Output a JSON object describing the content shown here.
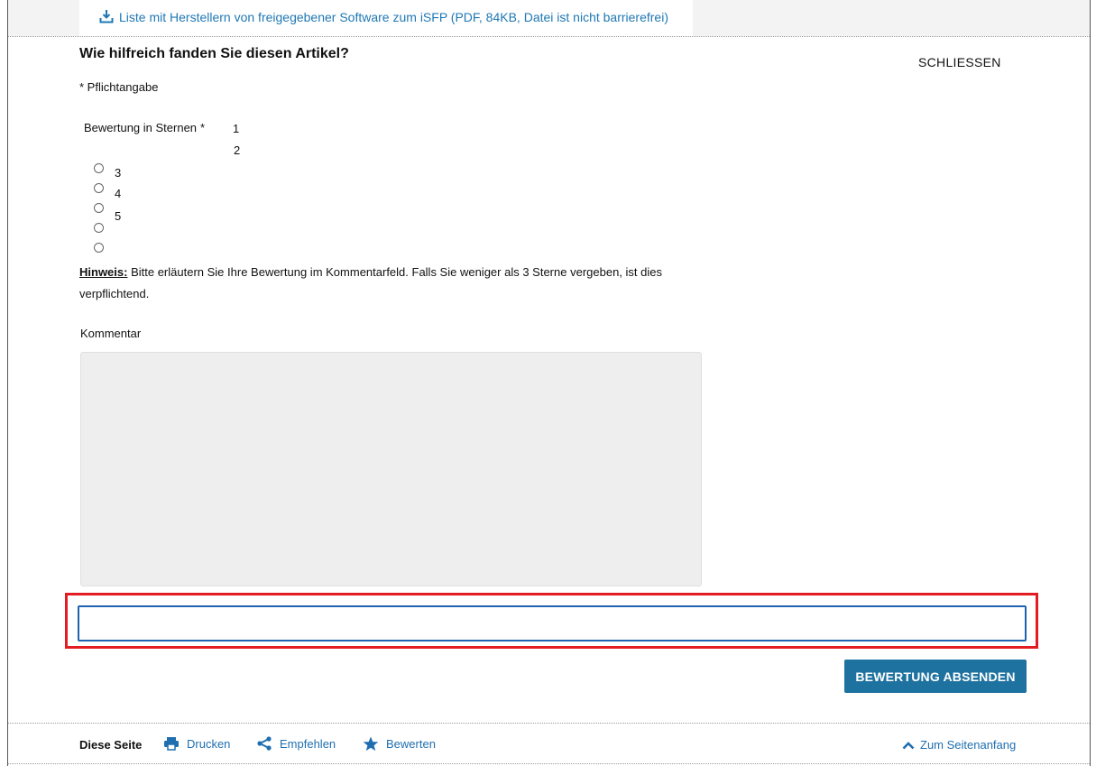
{
  "top_link": {
    "text": "Liste mit Herstellern von freigegebener Software zum iSFP (PDF, 84KB, Datei ist nicht barrierefrei)"
  },
  "dialog": {
    "title": "Wie hilfreich fanden Sie diesen Artikel?",
    "close_label": "SCHLIESSEN",
    "required_note": "* Pflichtangabe",
    "rating": {
      "label": "Bewertung in Sternen",
      "required_mark": "*",
      "options": [
        "1",
        "2",
        "3",
        "4",
        "5"
      ]
    },
    "hint": {
      "label": "Hinweis:",
      "text": " Bitte erläutern Sie Ihre Bewertung im Kommentarfeld. Falls Sie weniger als 3 Sterne vergeben, ist dies verpflichtend."
    },
    "comment": {
      "label": "Kommentar",
      "value": ""
    },
    "text_field": {
      "value": ""
    },
    "submit_label": "BEWERTUNG ABSENDEN"
  },
  "footer": {
    "label": "Diese Seite",
    "actions": [
      {
        "label": "Drucken",
        "icon": "printer-icon"
      },
      {
        "label": "Empfehlen",
        "icon": "share-icon"
      },
      {
        "label": "Bewerten",
        "icon": "star-icon"
      }
    ],
    "back_to_top": "Zum Seitenanfang"
  },
  "colors": {
    "link": "#1f78b4",
    "primary_button": "#1e72a0",
    "highlight": "#e31c23",
    "input_border": "#1f62b2"
  }
}
